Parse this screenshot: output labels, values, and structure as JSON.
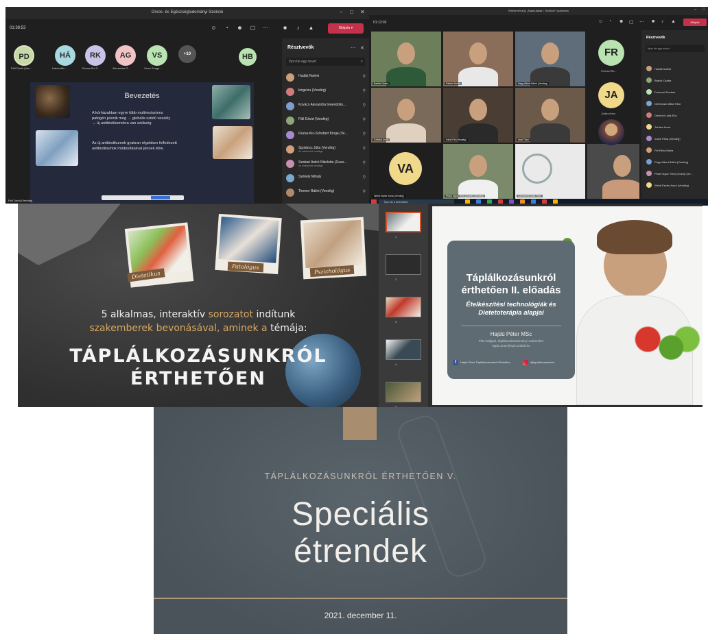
{
  "teams_meeting": {
    "window_title": "Orvos- és Egészségtudományi Szekció",
    "elapsed_time": "01:38:53",
    "leave_label": "Kilépés",
    "participants_avatars": [
      {
        "initials": "PD",
        "name": "Páll Dávid (Ven...",
        "color": "#c7d9a8"
      },
      {
        "initials": "HÁ",
        "name": "Hatzhoffer ...",
        "color": "#a8d8e0"
      },
      {
        "initials": "RK",
        "name": "Ruzsa-Kis S...",
        "color": "#c9c3e8"
      },
      {
        "initials": "AG",
        "name": "Alexandra G...",
        "color": "#f0c4c4"
      },
      {
        "initials": "VS",
        "name": "Vince Szege...",
        "color": "#b9e3b0"
      },
      {
        "initials": "+10",
        "name": "",
        "color": "#555555"
      },
      {
        "initials": "HB",
        "name": "",
        "color": "#b9e3b0"
      }
    ],
    "slide": {
      "title": "Bevezetés",
      "paragraph1_line1": "A kórházakban egyre több multirezisztens",
      "paragraph1_line2": "patogén jelenik meg → globális szintű veszély",
      "paragraph1_line3": "→ új antibiotikumokra van szükség",
      "paragraph2_line1": "Az új antibiotikumok gyakran régebben felfedezett",
      "paragraph2_line2": "antibiotikumok módosításával jönnek létre."
    },
    "speaker_label": "Páll Dávid (Vendég)",
    "roster": {
      "title": "Résztvevők",
      "search_placeholder": "Írjon be egy nevet",
      "items": [
        {
          "name": "Hudák Noémi",
          "sub": "",
          "color": "#c9a07d"
        },
        {
          "name": "kingsízu (Vendég)",
          "sub": "",
          "color": "#d07c7c"
        },
        {
          "name": "Kovács Alexandra Gwendolin...",
          "sub": "",
          "color": "#7c9fd0"
        },
        {
          "name": "Páll Dávid (Vendég)",
          "sub": "",
          "color": "#8fa67a"
        },
        {
          "name": "Ruzsa-Kis-Schubert Kinga (Ve...",
          "sub": "",
          "color": "#a58ad0"
        },
        {
          "name": "Spolárics Júlia (Vendég)",
          "sub": "Az értekezlet vendége",
          "color": "#d0a07c"
        },
        {
          "name": "Szabari Anikó Nikoletta (Gues...",
          "sub": "Az értekezlet vendége",
          "color": "#c98fb0"
        },
        {
          "name": "Székely Mihály",
          "sub": "",
          "color": "#7ca8d0"
        },
        {
          "name": "Timmer Bálint (Vendég)",
          "sub": "",
          "color": "#b08a6a"
        }
      ]
    }
  },
  "gallery_meeting": {
    "window_title": "Értekezlet a(z) „Alapkutatás I. Szekció\" csatornán",
    "elapsed_time": "01:12:02",
    "leave_label": "Kilépés",
    "tiles": [
      {
        "name": "Bartók Csaba"
      },
      {
        "name": "Fábián Zsófia"
      },
      {
        "name": "Nagy Albert Bálint (Vendég)"
      },
      {
        "name": "Szilvási Anna"
      },
      {
        "name": "Ivánfi Pál (Vendég)"
      },
      {
        "name": "Imre Tibor"
      },
      {
        "name": "Weidl Eszter Anna (Vendég)"
      },
      {
        "name": "Pham Ngoc Trinh (Guest) (Vendég)"
      },
      {
        "name": "Szemerédi Attila Tibor"
      },
      {
        "name": ""
      }
    ],
    "side_avatars": [
      {
        "initials": "FR",
        "name": "Ferenczi Ro...",
        "color": "#b9e3b0"
      },
      {
        "initials": "JA",
        "name": "Juhász Anna",
        "color": "#f0d98a"
      },
      {
        "initials": "VA",
        "name": "",
        "color": "#f0d98a"
      }
    ],
    "roster": {
      "title": "Résztvevők",
      "search_placeholder": "Írjon be egy nevet",
      "items": [
        {
          "name": "Hudák Noémi",
          "color": "#c9a07d"
        },
        {
          "name": "Bartók Csaba",
          "color": "#8fa67a"
        },
        {
          "name": "Ferenczi Roxána",
          "color": "#b9e3b0"
        },
        {
          "name": "Gerencsér Attila Tibor",
          "color": "#7ca8d0"
        },
        {
          "name": "Gerevici Lídia Éva",
          "color": "#d07c7c"
        },
        {
          "name": "Juhász Anna",
          "color": "#f0d98a"
        },
        {
          "name": "marie FElia (Vendég)",
          "color": "#a58ad0"
        },
        {
          "name": "Pál Réka Mária",
          "color": "#d0a07c"
        },
        {
          "name": "Papp Albert Bálint (Vendég)",
          "color": "#7c9fd0"
        },
        {
          "name": "Pham Ngoc Trinh (Guest) (Ve...",
          "color": "#c98fb0"
        },
        {
          "name": "Weidl Eszter Anna (Vendég)",
          "color": "#f0d98a"
        }
      ]
    },
    "taskbar_search": "Írjon ide a kereséshez"
  },
  "poster": {
    "tag1": "Dietetikus",
    "tag2": "Patológus",
    "tag3": "Pszichológus",
    "intro_line1_part1": "5 alkalmas, interaktív",
    "intro_line1_part2": "sorozatot",
    "intro_line1_part3": "indítunk",
    "intro_line2_part1": "szakemberek bevonásával, aminek a",
    "intro_line2_part2": "témája:",
    "headline_line1": "TÁPLÁLKOZÁSUNKRÓL",
    "headline_line2": "ÉRTHETŐEN",
    "accent_color": "#d9a860"
  },
  "ppt_editor": {
    "thumb_numbers": [
      "1",
      "2",
      "3",
      "4",
      "5"
    ],
    "slide": {
      "title_line1": "Táplálkozásunkról",
      "title_line2": "érthetően II. előadás",
      "subtitle_line1": "Ételkészítési technológiák és",
      "subtitle_line2": "Dietetoterápia alapjai",
      "presenter": "Hajdú Péter MSc",
      "presenter_role": "PhD hallgató, táplálkozástudományi szakember",
      "presenter_email": "hajdu.peter@sph.unideb.hu",
      "facebook_label": "Hajdú Péter Táplálkozásunkról Érthetően",
      "instagram_label": "@taplalkozasunkrol"
    }
  },
  "title_slide": {
    "series": "TÁPLÁLKOZÁSUNKRÓL ÉRTHETŐEN V.",
    "title_line1": "Speciális",
    "title_line2": "étrendek",
    "date": "2021. december 11."
  }
}
